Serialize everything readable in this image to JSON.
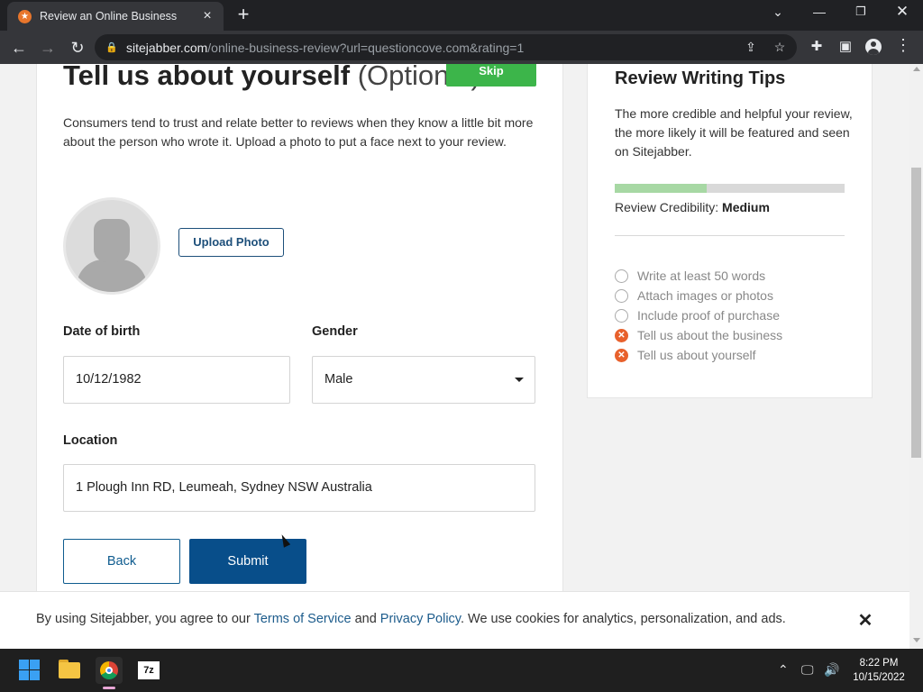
{
  "browser": {
    "tab_title": "Review an Online Business",
    "new_tab_symbol": "+",
    "url_domain": "sitejabber.com",
    "url_path": "/online-business-review?url=questioncove.com&rating=1"
  },
  "page": {
    "heading": "Tell us about yourself",
    "heading_optional": "(Optional)",
    "skip_label": "Skip",
    "intro": "Consumers tend to trust and relate better to reviews when they know a little bit more about the person who wrote it. Upload a photo to put a face next to your review.",
    "upload_label": "Upload Photo",
    "dob_label": "Date of birth",
    "dob_value": "10/12/1982",
    "gender_label": "Gender",
    "gender_value": "Male",
    "location_label": "Location",
    "location_value": "1 Plough Inn RD, Leumeah, Sydney NSW Australia",
    "back_label": "Back",
    "submit_label": "Submit"
  },
  "tips": {
    "title": "Review Writing Tips",
    "text": "The more credible and helpful your review, the more likely it will be featured and seen on Sitejabber.",
    "credibility_label": "Review Credibility: ",
    "credibility_value": "Medium",
    "credibility_fraction": 0.4,
    "items": [
      {
        "label": "Write at least 50 words",
        "status": "empty"
      },
      {
        "label": "Attach images or photos",
        "status": "empty"
      },
      {
        "label": "Include proof of purchase",
        "status": "empty"
      },
      {
        "label": "Tell us about the business",
        "status": "missing"
      },
      {
        "label": "Tell us about yourself",
        "status": "missing"
      }
    ]
  },
  "cookie": {
    "text_before": "By using Sitejabber, you agree to our ",
    "terms_link": "Terms of Service",
    "and": " and ",
    "privacy_link": "Privacy Policy",
    "text_after": ". We use cookies for analytics, personalization, and ads."
  },
  "taskbar": {
    "z7_label": "7z",
    "time": "8:22 PM",
    "date": "10/15/2022"
  },
  "colors": {
    "skip_green": "#3cb54a",
    "submit_blue": "#084e8a",
    "link_blue": "#1d5c8c",
    "missing_orange": "#e8612c",
    "credibility_fill": "#a7d8a4"
  }
}
